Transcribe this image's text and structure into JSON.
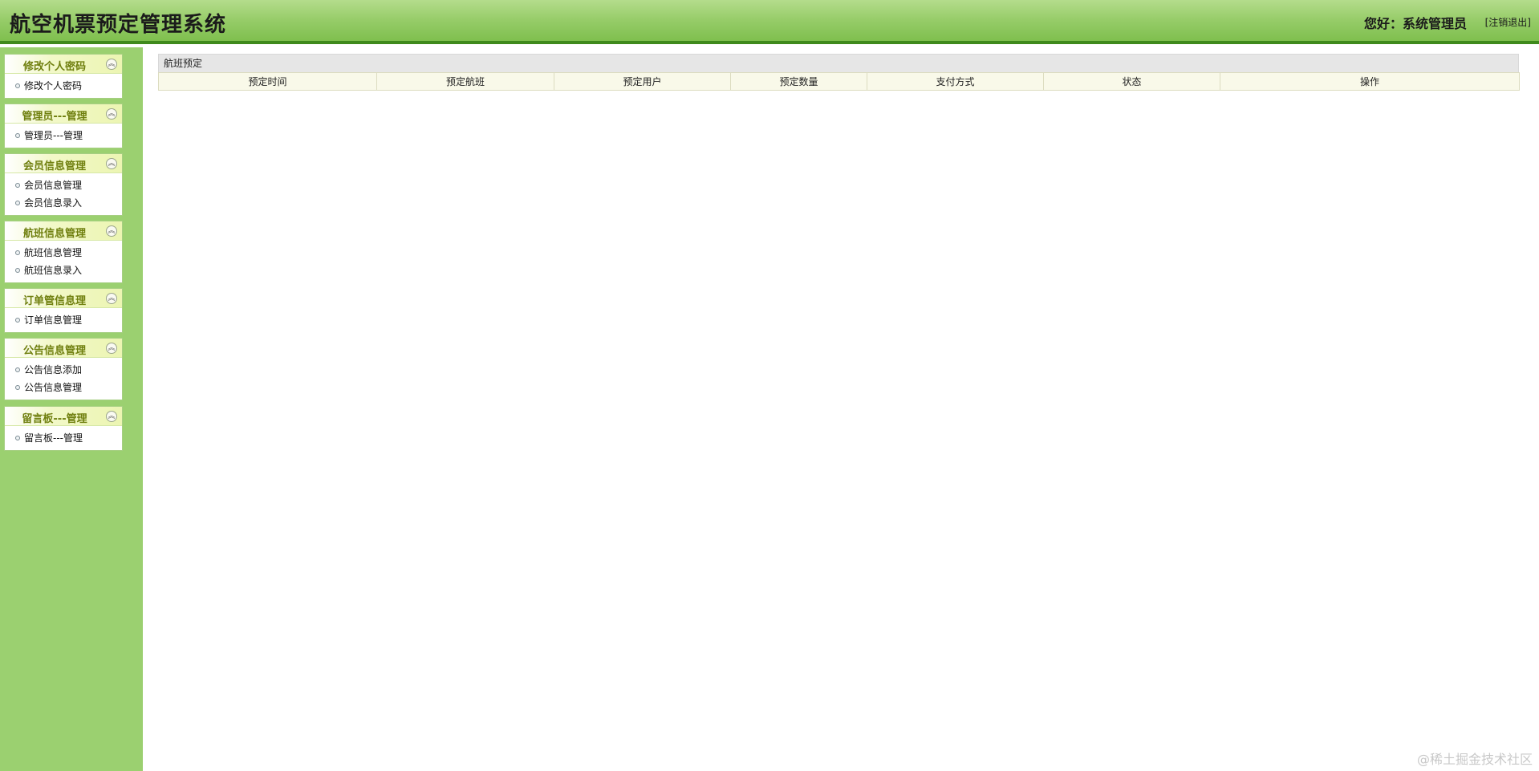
{
  "header": {
    "title": "航空机票预定管理系统",
    "greeting": "您好：系统管理员",
    "logout_label": "[注销退出]"
  },
  "sidebar": {
    "groups": [
      {
        "title": "修改个人密码",
        "items": [
          "修改个人密码"
        ]
      },
      {
        "title": "管理员---管理",
        "items": [
          "管理员---管理"
        ]
      },
      {
        "title": "会员信息管理",
        "items": [
          "会员信息管理",
          "会员信息录入"
        ]
      },
      {
        "title": "航班信息管理",
        "items": [
          "航班信息管理",
          "航班信息录入"
        ]
      },
      {
        "title": "订单管信息理",
        "items": [
          "订单信息管理"
        ]
      },
      {
        "title": "公告信息管理",
        "items": [
          "公告信息添加",
          "公告信息管理"
        ]
      },
      {
        "title": "留言板---管理",
        "items": [
          "留言板---管理"
        ]
      }
    ]
  },
  "main": {
    "panel_title": "航班预定",
    "columns": [
      "预定时间",
      "预定航班",
      "预定用户",
      "预定数量",
      "支付方式",
      "状态",
      "操作"
    ]
  },
  "watermark": "@稀土掘金技术社区",
  "colors": {
    "header_border": "#3f8a1c",
    "sidebar_bg": "#9bd070",
    "menu_title": "#6f7f0e"
  }
}
